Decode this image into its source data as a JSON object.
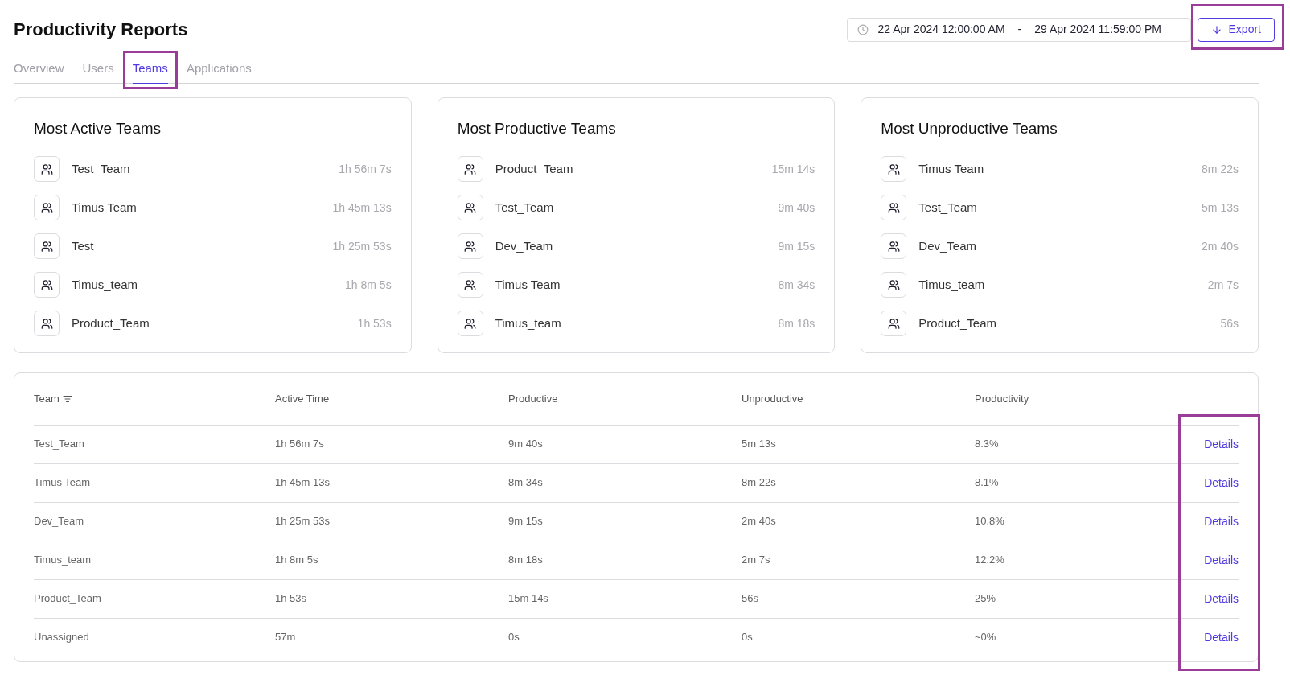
{
  "title": "Productivity Reports",
  "date_range": {
    "start": "22 Apr 2024 12:00:00 AM",
    "separator": "-",
    "end": "29 Apr 2024 11:59:00 PM"
  },
  "export": {
    "label": "Export",
    "highlighted": true
  },
  "tabs": [
    {
      "label": "Overview",
      "selected": false
    },
    {
      "label": "Users",
      "selected": false
    },
    {
      "label": "Teams",
      "selected": true,
      "highlighted": true
    },
    {
      "label": "Applications",
      "selected": false
    }
  ],
  "cards": [
    {
      "title": "Most Active Teams",
      "items": [
        {
          "name": "Test_Team",
          "time": "1h 56m 7s"
        },
        {
          "name": "Timus Team",
          "time": "1h 45m 13s"
        },
        {
          "name": "Test",
          "time": "1h 25m 53s"
        },
        {
          "name": "Timus_team",
          "time": "1h 8m 5s"
        },
        {
          "name": "Product_Team",
          "time": "1h 53s"
        }
      ]
    },
    {
      "title": "Most Productive Teams",
      "items": [
        {
          "name": "Product_Team",
          "time": "15m 14s"
        },
        {
          "name": "Test_Team",
          "time": "9m 40s"
        },
        {
          "name": "Dev_Team",
          "time": "9m 15s"
        },
        {
          "name": "Timus Team",
          "time": "8m 34s"
        },
        {
          "name": "Timus_team",
          "time": "8m 18s"
        }
      ]
    },
    {
      "title": "Most Unproductive Teams",
      "items": [
        {
          "name": "Timus Team",
          "time": "8m 22s"
        },
        {
          "name": "Test_Team",
          "time": "5m 13s"
        },
        {
          "name": "Dev_Team",
          "time": "2m 40s"
        },
        {
          "name": "Timus_team",
          "time": "2m 7s"
        },
        {
          "name": "Product_Team",
          "time": "56s"
        }
      ]
    }
  ],
  "table": {
    "columns": [
      {
        "label": "Team",
        "kind": "sortable"
      },
      {
        "label": "Active Time",
        "kind": "plain"
      },
      {
        "label": "Productive",
        "kind": "plain"
      },
      {
        "label": "Unproductive",
        "kind": "plain"
      },
      {
        "label": "Productivity",
        "kind": "plain"
      }
    ],
    "details_highlighted": true,
    "rows": [
      {
        "cells": [
          "Test_Team",
          "1h 56m 7s",
          "9m 40s",
          "5m 13s",
          "8.3%"
        ],
        "action": "Details"
      },
      {
        "cells": [
          "Timus Team",
          "1h 45m 13s",
          "8m 34s",
          "8m 22s",
          "8.1%"
        ],
        "action": "Details"
      },
      {
        "cells": [
          "Dev_Team",
          "1h 25m 53s",
          "9m 15s",
          "2m 40s",
          "10.8%"
        ],
        "action": "Details"
      },
      {
        "cells": [
          "Timus_team",
          "1h 8m 5s",
          "8m 18s",
          "2m 7s",
          "12.2%"
        ],
        "action": "Details"
      },
      {
        "cells": [
          "Product_Team",
          "1h 53s",
          "15m 14s",
          "56s",
          "25%"
        ],
        "action": "Details"
      },
      {
        "cells": [
          "Unassigned",
          "57m",
          "0s",
          "0s",
          "~0%"
        ],
        "action": "Details"
      }
    ]
  }
}
